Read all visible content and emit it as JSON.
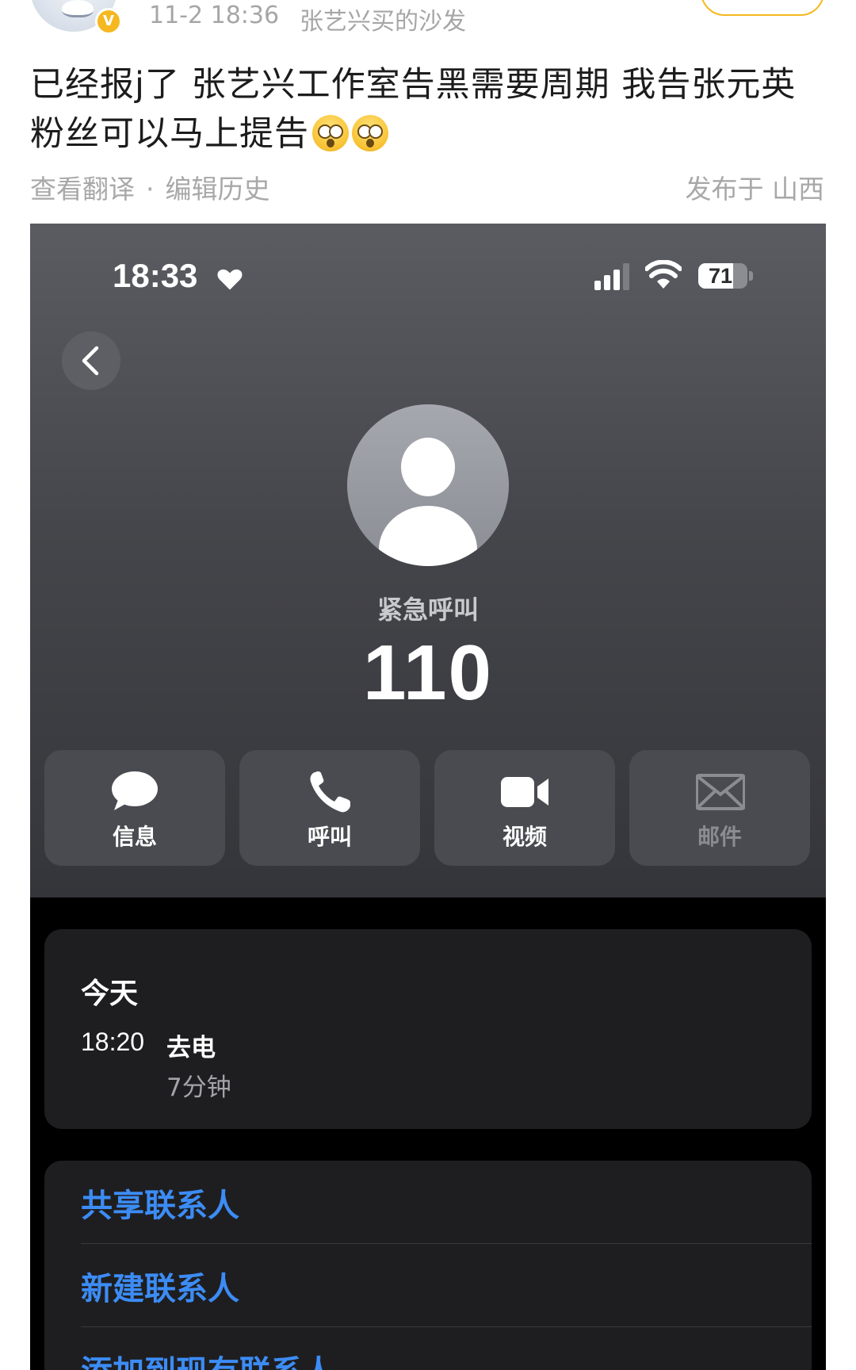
{
  "post": {
    "time": "11-2 18:36",
    "source": "张艺兴买的沙发",
    "verified_badge": "V",
    "text": "已经报j了 张艺兴工作室告黑需要周期 我告张元英粉丝可以马上提告",
    "emoji_icon": "flushed-face-icon",
    "translate_link": "查看翻译",
    "separator": "·",
    "history_link": "编辑历史",
    "location": "发布于 山西",
    "accent_color": "#f6b820"
  },
  "phone": {
    "status_bar": {
      "time": "18:33",
      "battery": "71",
      "battery_level": 0.71
    },
    "contact": {
      "label": "紧急呼叫",
      "number": "110"
    },
    "actions": [
      {
        "label": "信息",
        "icon": "message-bubble-icon",
        "enabled": true
      },
      {
        "label": "呼叫",
        "icon": "phone-icon",
        "enabled": true
      },
      {
        "label": "视频",
        "icon": "video-camera-icon",
        "enabled": true
      },
      {
        "label": "邮件",
        "icon": "mail-icon",
        "enabled": false
      }
    ],
    "recents": {
      "day": "今天",
      "time": "18:20",
      "type": "去电",
      "duration": "7分钟"
    },
    "options": [
      "共享联系人",
      "新建联系人",
      "添加到现有联系人"
    ],
    "link_color": "#3c8cf5"
  }
}
